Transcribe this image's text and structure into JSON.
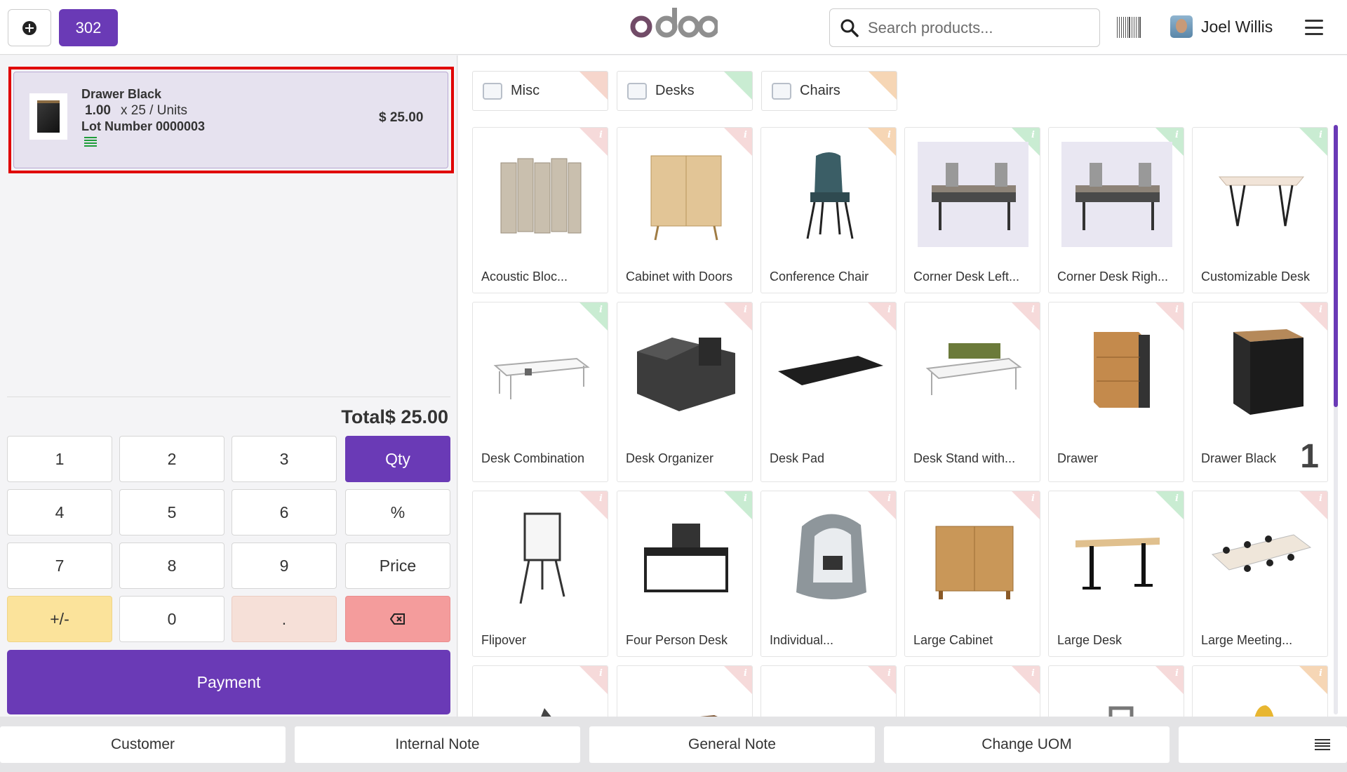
{
  "header": {
    "order_number": "302",
    "logo": "odoo",
    "search_placeholder": "Search products...",
    "user_name": "Joel Willis"
  },
  "order": {
    "line": {
      "product": "Drawer Black",
      "quantity": "1.00",
      "unit_price": "x 25 / Units",
      "lot": "Lot Number 0000003",
      "price": "$ 25.00"
    },
    "total": "Total$ 25.00"
  },
  "numpad": {
    "keys": [
      "1",
      "2",
      "3",
      "Qty",
      "4",
      "5",
      "6",
      "%",
      "7",
      "8",
      "9",
      "Price",
      "+/-",
      "0",
      ".",
      "backspace"
    ],
    "payment": "Payment"
  },
  "categories": [
    {
      "label": "Misc",
      "color": "#f6d6cc"
    },
    {
      "label": "Desks",
      "color": "#c9ecd2"
    },
    {
      "label": "Chairs",
      "color": "#f6d6b5"
    }
  ],
  "products": [
    {
      "name": "Acoustic Bloc...",
      "corner": "red"
    },
    {
      "name": "Cabinet with Doors",
      "corner": "red"
    },
    {
      "name": "Conference Chair",
      "corner": "orange"
    },
    {
      "name": "Corner Desk Left...",
      "corner": "green"
    },
    {
      "name": "Corner Desk Righ...",
      "corner": "green"
    },
    {
      "name": "Customizable Desk",
      "corner": "green"
    },
    {
      "name": "Desk Combination",
      "corner": "green"
    },
    {
      "name": "Desk Organizer",
      "corner": "red"
    },
    {
      "name": "Desk Pad",
      "corner": "red"
    },
    {
      "name": "Desk Stand with...",
      "corner": "red"
    },
    {
      "name": "Drawer",
      "corner": "red"
    },
    {
      "name": "Drawer Black",
      "corner": "red",
      "qty_badge": "1"
    },
    {
      "name": "Flipover",
      "corner": "red"
    },
    {
      "name": "Four Person Desk",
      "corner": "green"
    },
    {
      "name": "Individual...",
      "corner": "red"
    },
    {
      "name": "Large Cabinet",
      "corner": "red"
    },
    {
      "name": "Large Desk",
      "corner": "green"
    },
    {
      "name": "Large Meeting...",
      "corner": "red"
    }
  ],
  "bottom_bar": {
    "customer": "Customer",
    "internal_note": "Internal Note",
    "general_note": "General Note",
    "change_uom": "Change UOM"
  },
  "colors": {
    "accent": "#6a3ab6",
    "highlight": "#e00000"
  }
}
